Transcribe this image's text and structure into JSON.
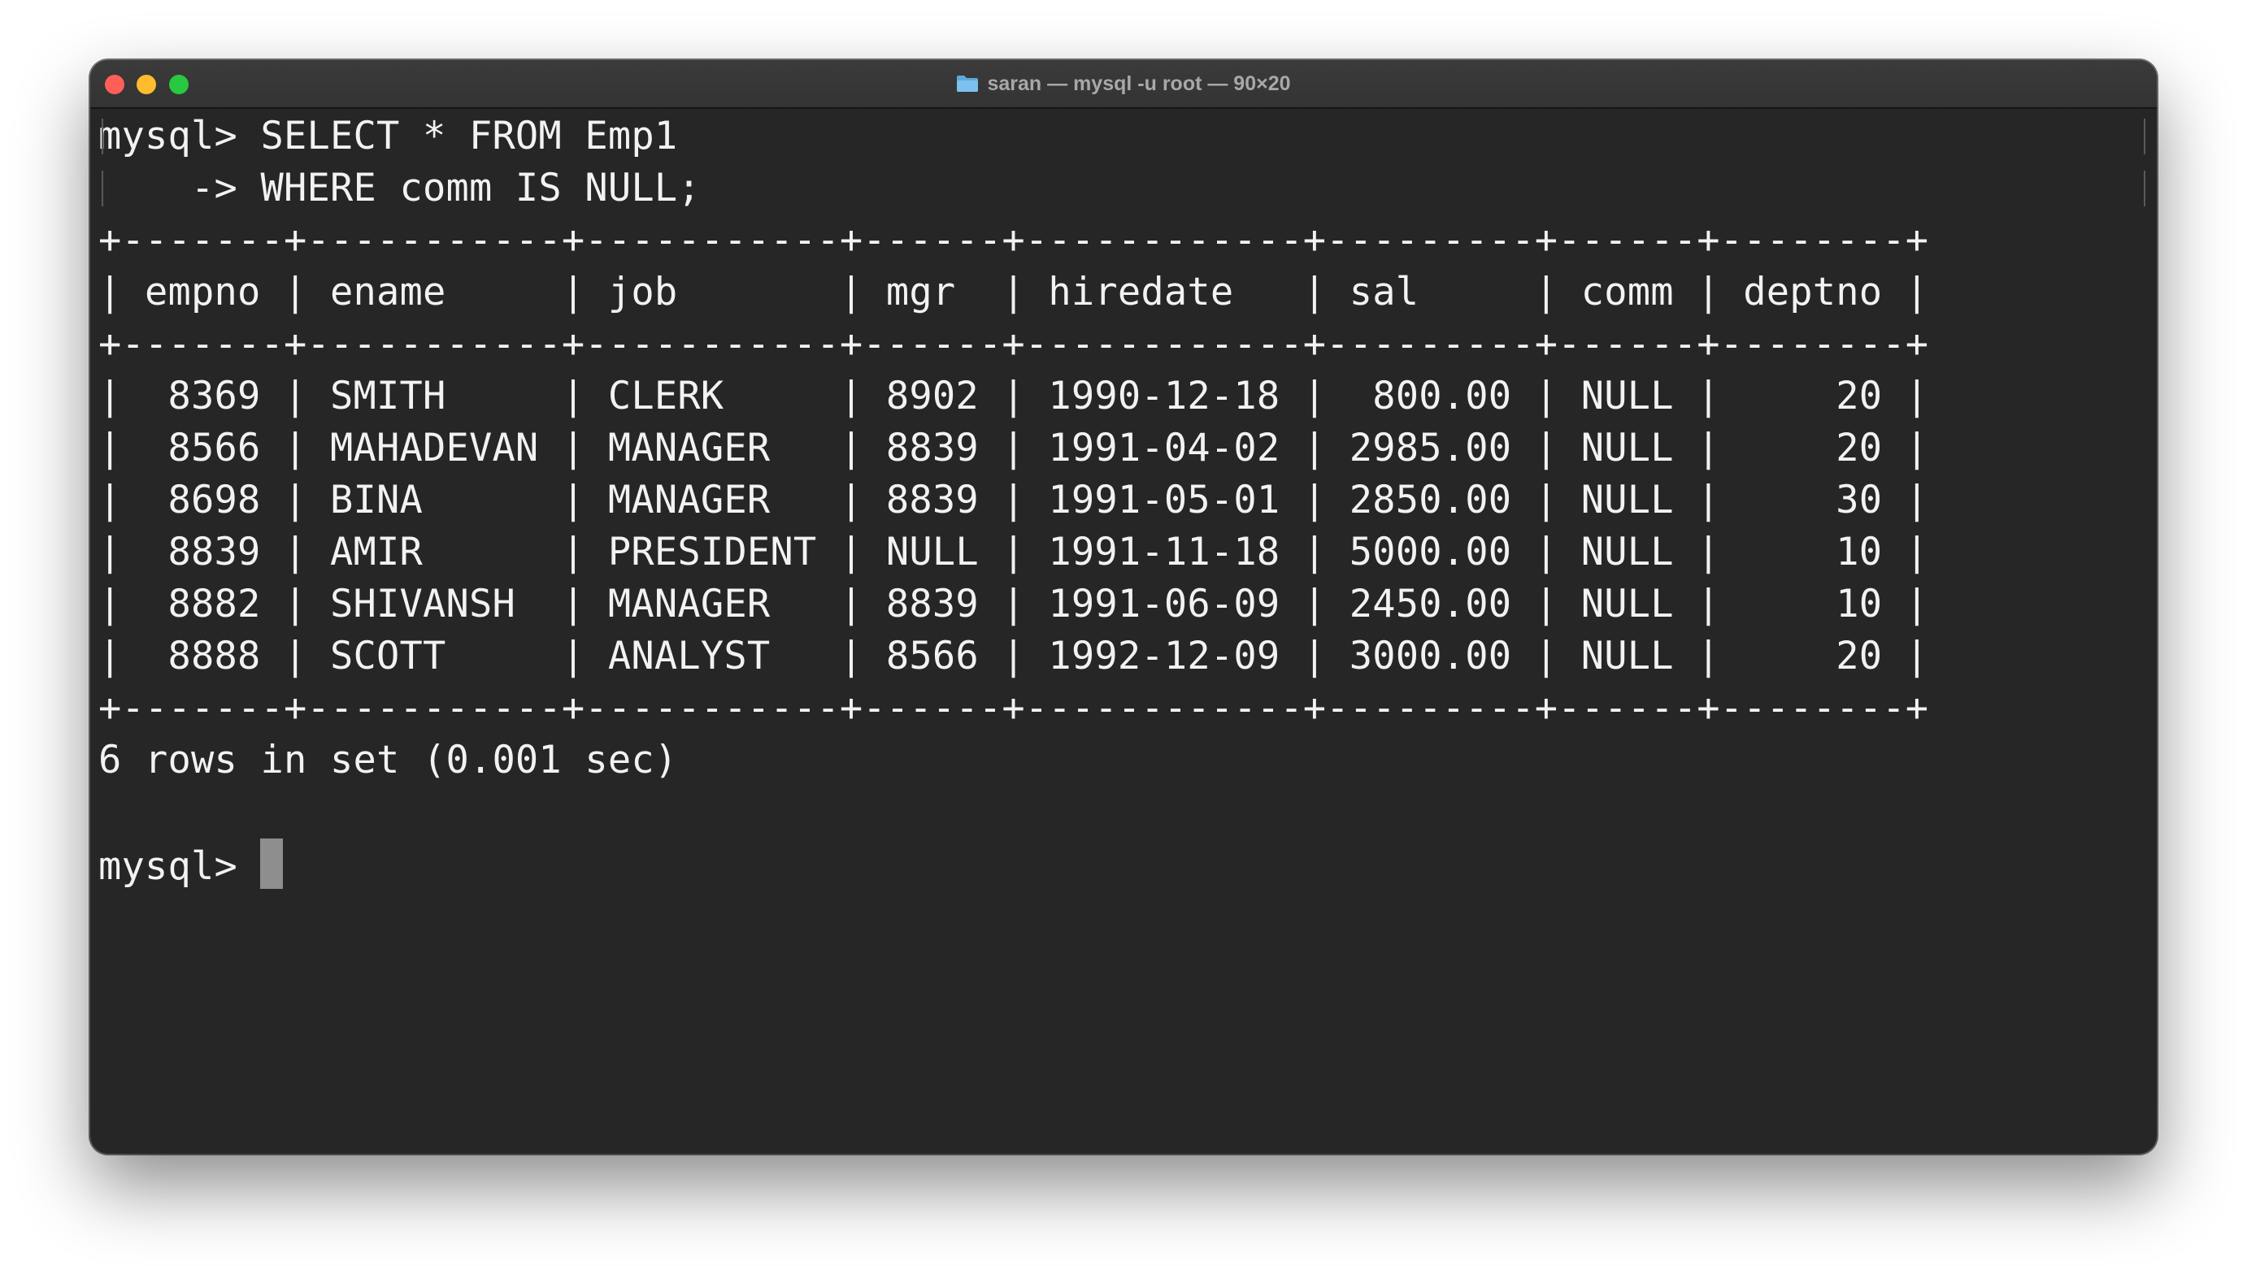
{
  "window": {
    "title": "saran — mysql -u root — 90×20",
    "folder_icon": "folder-icon",
    "buttons": {
      "close_color": "#fe5f57",
      "minimize_color": "#febc2e",
      "maximize_color": "#28c840"
    }
  },
  "terminal": {
    "query_line_1": "mysql> SELECT * FROM Emp1",
    "query_line_2": "    -> WHERE comm IS NULL;",
    "separator": "+-------+-----------+-----------+------+------------+---------+------+--------+",
    "header_row": "| empno | ename     | job       | mgr  | hiredate   | sal     | comm | deptno |",
    "columns": [
      "empno",
      "ename",
      "job",
      "mgr",
      "hiredate",
      "sal",
      "comm",
      "deptno"
    ],
    "rows": [
      "|  8369 | SMITH     | CLERK     | 8902 | 1990-12-18 |  800.00 | NULL |     20 |",
      "|  8566 | MAHADEVAN | MANAGER   | 8839 | 1991-04-02 | 2985.00 | NULL |     20 |",
      "|  8698 | BINA      | MANAGER   | 8839 | 1991-05-01 | 2850.00 | NULL |     30 |",
      "|  8839 | AMIR      | PRESIDENT | NULL | 1991-11-18 | 5000.00 | NULL |     10 |",
      "|  8882 | SHIVANSH  | MANAGER   | 8839 | 1991-06-09 | 2450.00 | NULL |     10 |",
      "|  8888 | SCOTT     | ANALYST   | 8566 | 1992-12-09 | 3000.00 | NULL |     20 |"
    ],
    "row_values": [
      [
        "8369",
        "SMITH",
        "CLERK",
        "8902",
        "1990-12-18",
        "800.00",
        "NULL",
        "20"
      ],
      [
        "8566",
        "MAHADEVAN",
        "MANAGER",
        "8839",
        "1991-04-02",
        "2985.00",
        "NULL",
        "20"
      ],
      [
        "8698",
        "BINA",
        "MANAGER",
        "8839",
        "1991-05-01",
        "2850.00",
        "NULL",
        "30"
      ],
      [
        "8839",
        "AMIR",
        "PRESIDENT",
        "NULL",
        "1991-11-18",
        "5000.00",
        "NULL",
        "10"
      ],
      [
        "8882",
        "SHIVANSH",
        "MANAGER",
        "8839",
        "1991-06-09",
        "2450.00",
        "NULL",
        "10"
      ],
      [
        "8888",
        "SCOTT",
        "ANALYST",
        "8566",
        "1992-12-09",
        "3000.00",
        "NULL",
        "20"
      ]
    ],
    "result_summary": "6 rows in set (0.001 sec)",
    "prompt": "mysql> "
  }
}
